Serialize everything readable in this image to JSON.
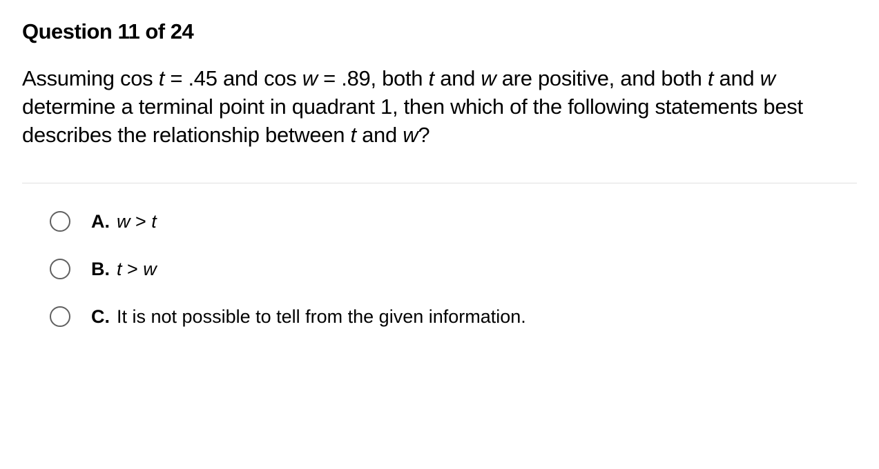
{
  "header": "Question 11 of 24",
  "question": {
    "prefix1": "Assuming cos ",
    "var_t1": "t",
    "mid1": " = .45 and cos ",
    "var_w1": "w",
    "mid2": " = .89, both ",
    "var_t2": "t ",
    "mid3": "and ",
    "var_w2": "w ",
    "mid4": "are positive, and both ",
    "var_t3": "t ",
    "mid5": "and ",
    "var_w3": "w ",
    "mid6": "determine a terminal point in quadrant 1, then which of the following statements best describes the relationship between ",
    "var_t4": "t ",
    "mid7": "and ",
    "var_w4": "w",
    "suffix": "?"
  },
  "options": {
    "a": {
      "label": "A.",
      "var1": "w",
      "op": " > ",
      "var2": "t"
    },
    "b": {
      "label": "B.",
      "var1": "t",
      "op": " > ",
      "var2": "w"
    },
    "c": {
      "label": "C.",
      "text": "It is not possible to tell from the given information."
    }
  }
}
